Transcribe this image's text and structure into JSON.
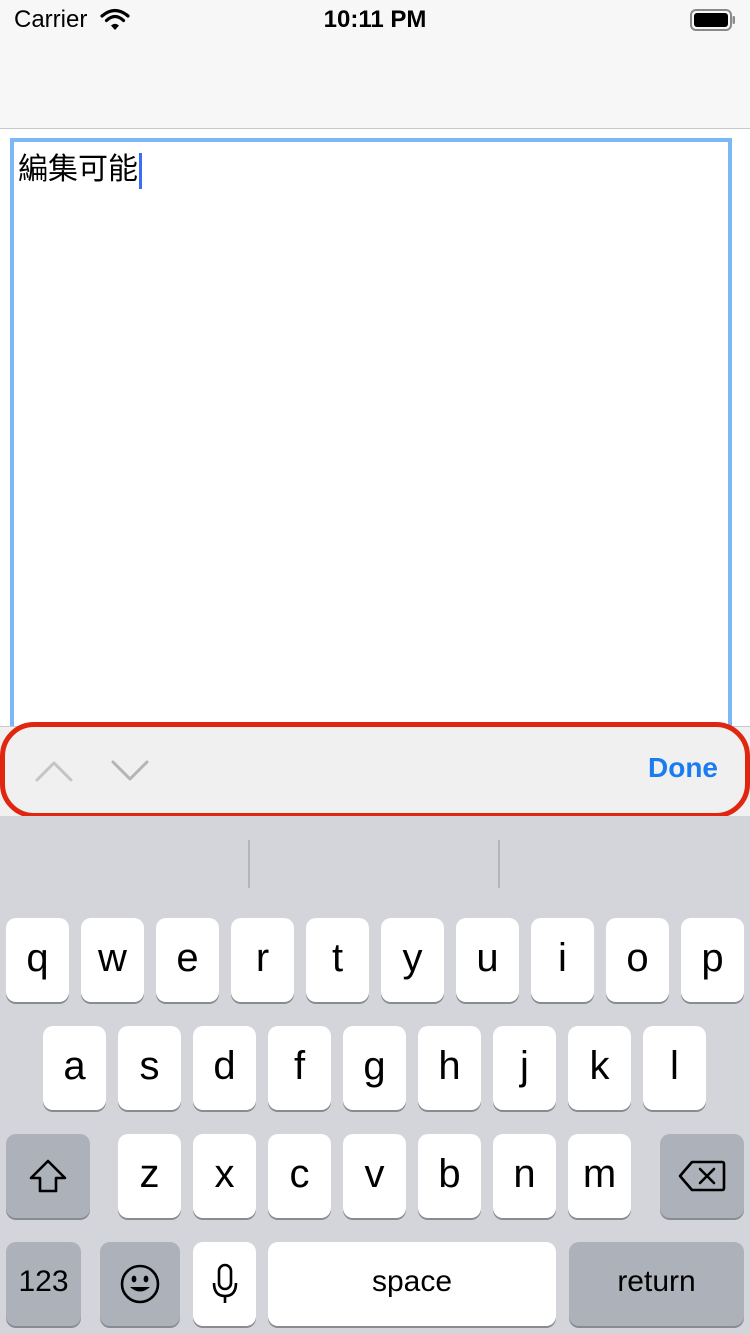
{
  "status_bar": {
    "carrier": "Carrier",
    "time": "10:11 PM"
  },
  "text_view": {
    "content": "編集可能"
  },
  "toolbar": {
    "done_label": "Done"
  },
  "keyboard": {
    "row1": [
      "q",
      "w",
      "e",
      "r",
      "t",
      "y",
      "u",
      "i",
      "o",
      "p"
    ],
    "row2": [
      "a",
      "s",
      "d",
      "f",
      "g",
      "h",
      "j",
      "k",
      "l"
    ],
    "row3": [
      "z",
      "x",
      "c",
      "v",
      "b",
      "n",
      "m"
    ],
    "numbers_label": "123",
    "space_label": "space",
    "return_label": "return"
  },
  "colors": {
    "accent": "#1a7cf0",
    "highlight": "#e0260f",
    "text_view_border": "#7eb7f6"
  },
  "icons": [
    "wifi-icon",
    "battery-icon",
    "chevron-up-icon",
    "chevron-down-icon",
    "shift-icon",
    "delete-icon",
    "emoji-icon",
    "microphone-icon"
  ]
}
